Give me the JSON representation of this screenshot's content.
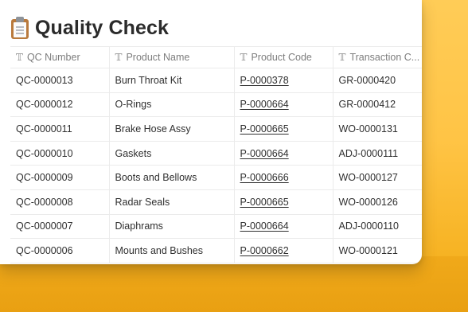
{
  "page": {
    "icon": "clipboard-icon",
    "title": "Quality Check"
  },
  "colors": {
    "background_gradient_top": "#ffcc57",
    "background_gradient_bottom": "#f2aa12",
    "panel": "#ffffff",
    "header_text": "#7d7d7d",
    "cell_text": "#2f2f2f"
  },
  "table": {
    "column_icon": "text-type-icon",
    "columns": [
      "QC Number",
      "Product Name",
      "Product Code",
      "Transaction C..."
    ],
    "rows": [
      {
        "qc_number": "QC-0000013",
        "product_name": "Burn Throat Kit",
        "product_code": "P-0000378",
        "transaction_code": "GR-0000420"
      },
      {
        "qc_number": "QC-0000012",
        "product_name": "O-Rings",
        "product_code": "P-0000664",
        "transaction_code": "GR-0000412"
      },
      {
        "qc_number": "QC-0000011",
        "product_name": "Brake Hose Assy",
        "product_code": "P-0000665",
        "transaction_code": "WO-0000131"
      },
      {
        "qc_number": "QC-0000010",
        "product_name": "Gaskets",
        "product_code": "P-0000664",
        "transaction_code": "ADJ-0000111"
      },
      {
        "qc_number": "QC-0000009",
        "product_name": "Boots and Bellows",
        "product_code": "P-0000666",
        "transaction_code": "WO-0000127"
      },
      {
        "qc_number": "QC-0000008",
        "product_name": "Radar Seals",
        "product_code": "P-0000665",
        "transaction_code": "WO-0000126"
      },
      {
        "qc_number": "QC-0000007",
        "product_name": "Diaphrams",
        "product_code": "P-0000664",
        "transaction_code": "ADJ-0000110"
      },
      {
        "qc_number": "QC-0000006",
        "product_name": "Mounts and Bushes",
        "product_code": "P-0000662",
        "transaction_code": "WO-0000121"
      }
    ]
  }
}
